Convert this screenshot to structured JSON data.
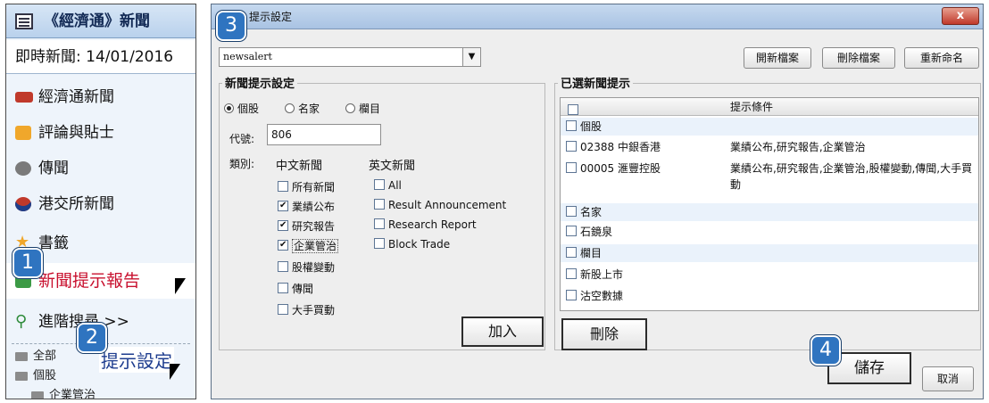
{
  "sidebar": {
    "header_title": "《經濟通》新聞",
    "subheader": "即時新聞: 14/01/2016",
    "items": [
      {
        "label": "經濟通新聞",
        "icon": "etnet-logo-icon"
      },
      {
        "label": "評論與貼士",
        "icon": "chat-bubble-icon"
      },
      {
        "label": "傳聞",
        "icon": "megaphone-icon"
      },
      {
        "label": "港交所新聞",
        "icon": "hkex-icon"
      },
      {
        "label": "書籤",
        "icon": "star-icon"
      },
      {
        "label": "新聞提示報告",
        "icon": "report-icon"
      },
      {
        "label": "進階搜尋 >>",
        "icon": "search-icon"
      }
    ],
    "tree": [
      {
        "label": "全部"
      },
      {
        "label": "個股"
      },
      {
        "label": "企業管治"
      }
    ],
    "callout_label": "提示設定"
  },
  "dialog": {
    "title": "提示設定",
    "close_label": "x",
    "profile_select": "newsalert",
    "buttons": {
      "new_file": "開新檔案",
      "delete_file": "刪除檔案",
      "rename": "重新命名",
      "add": "加入",
      "remove": "刪除",
      "save": "儲存",
      "cancel": "取消"
    },
    "settings": {
      "legend": "新聞提示設定",
      "radios": [
        {
          "label": "個股",
          "selected": true
        },
        {
          "label": "名家",
          "selected": false
        },
        {
          "label": "欄目",
          "selected": false
        }
      ],
      "code_label": "代號:",
      "code_value": "806",
      "category_label": "類別:",
      "chinese_header": "中文新聞",
      "english_header": "英文新聞",
      "chinese_news": [
        {
          "label": "所有新聞",
          "checked": false
        },
        {
          "label": "業績公布",
          "checked": true
        },
        {
          "label": "研究報告",
          "checked": true
        },
        {
          "label": "企業管治",
          "checked": true
        },
        {
          "label": "股權變動",
          "checked": false
        },
        {
          "label": "傳聞",
          "checked": false
        },
        {
          "label": "大手買動",
          "checked": false
        }
      ],
      "english_news": [
        {
          "label": "All",
          "checked": false
        },
        {
          "label": "Result Announcement",
          "checked": false
        },
        {
          "label": "Research Report",
          "checked": false
        },
        {
          "label": "Block Trade",
          "checked": false
        }
      ]
    },
    "selected": {
      "legend": "已選新聞提示",
      "column_condition": "提示條件",
      "rows": [
        {
          "type": "group",
          "name": "個股",
          "condition": ""
        },
        {
          "type": "item",
          "name": "02388  中銀香港",
          "condition": "業績公布,研究報告,企業管治"
        },
        {
          "type": "item",
          "name": "00005  滙豐控股",
          "condition": "業績公布,研究報告,企業管治,股權變動,傳聞,大手買動"
        },
        {
          "type": "group",
          "name": "名家",
          "condition": ""
        },
        {
          "type": "item",
          "name": "石鏡泉",
          "condition": ""
        },
        {
          "type": "group",
          "name": "欄目",
          "condition": ""
        },
        {
          "type": "item",
          "name": "新股上市",
          "condition": ""
        },
        {
          "type": "item",
          "name": "沽空數據",
          "condition": ""
        }
      ]
    }
  },
  "steps": [
    "1",
    "2",
    "3",
    "4"
  ],
  "colors": {
    "accent": "#2f74c0",
    "active_text": "#c8102e",
    "title_bar": "#a9c3e3",
    "close_button": "#c0392b"
  }
}
